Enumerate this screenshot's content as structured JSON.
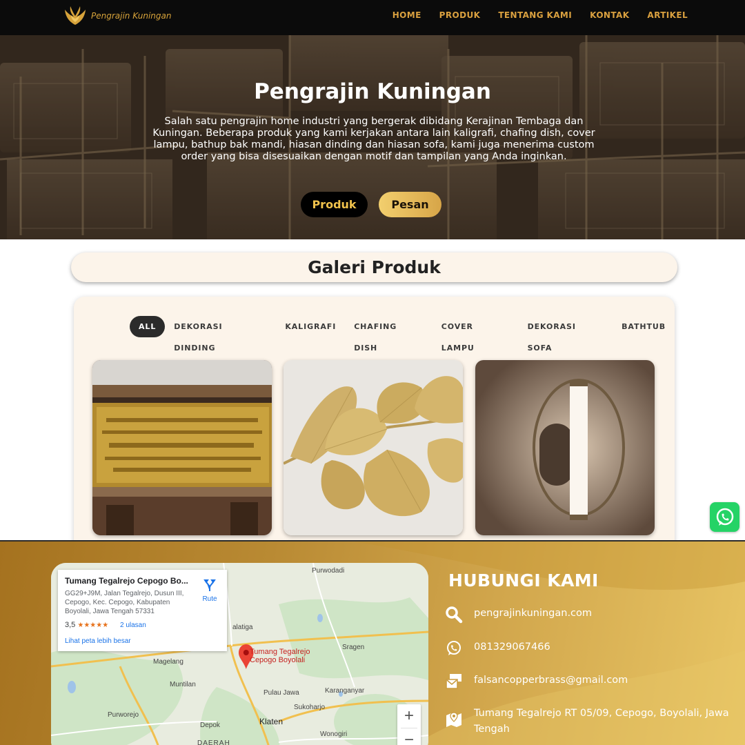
{
  "nav": {
    "logo_text": "Pengrajin Kuningan",
    "items": [
      {
        "label": "HOME"
      },
      {
        "label": "PRODUK"
      },
      {
        "label": "TENTANG KAMI"
      },
      {
        "label": "KONTAK"
      },
      {
        "label": "ARTIKEL"
      }
    ]
  },
  "hero": {
    "title": "Pengrajin Kuningan",
    "description": "Salah satu pengrajin home industri yang bergerak dibidang Kerajinan Tembaga dan Kuningan. Beberapa produk yang kami kerjakan antara lain kaligrafi, chafing dish, cover lampu, bathup bak mandi, hiasan dinding dan hiasan sofa, kami juga menerima custom order yang bisa disesuaikan dengan motif dan tampilan yang Anda inginkan.",
    "btn_produk": "Produk",
    "btn_pesan": "Pesan"
  },
  "gallery": {
    "title": "Galeri Produk",
    "filters": [
      "ALL",
      "DEKORASI DINDING",
      "KALIGRAFI",
      "CHAFING DISH",
      "COVER LAMPU",
      "DEKORASI SOFA",
      "BATHTUB"
    ],
    "active_filter": "ALL"
  },
  "map": {
    "place_title": "Tumang Tegalrejo Cepogo Bo...",
    "address": "GG29+J9M, Jalan Tegalrejo, Dusun III, Cepogo, Kec. Cepogo, Kabupaten Boyolali, Jawa Tengah 57331",
    "rating": "3,5",
    "stars": "★★★★★",
    "reviews": "2 ulasan",
    "larger_map": "Lihat peta lebih besar",
    "route": "Rute",
    "pin_label": "Tumang Tegalrejo Cepogo Boyolali",
    "places": {
      "purwodadi": "Purwodadi",
      "salatiga": "alatiga",
      "sragen": "Sragen",
      "magelang": "Magelang",
      "muntilan": "Muntilan",
      "pulau_jawa": "Pulau Jawa",
      "karanganyar": "Karanganyar",
      "purworejo": "Purworejo",
      "sukoharjo": "Sukoharjo",
      "depok": "Depok",
      "klaten": "Klaten",
      "wonogiri": "Wonogiri",
      "daerah": "DAERAH"
    },
    "zoom_in": "+",
    "zoom_out": "−"
  },
  "contact": {
    "title": "HUBUNGI KAMI",
    "website": "pengrajinkuningan.com",
    "phone": "081329067466",
    "email": "falsancopperbrass@gmail.com",
    "address": "Tumang Tegalrejo RT 05/09, Cepogo, Boyolali, Jawa Tengah"
  },
  "colors": {
    "gold": "#d9a03f",
    "nav_bg": "#0b0b0b",
    "cream": "#fcf4ea",
    "whatsapp": "#25d366"
  }
}
